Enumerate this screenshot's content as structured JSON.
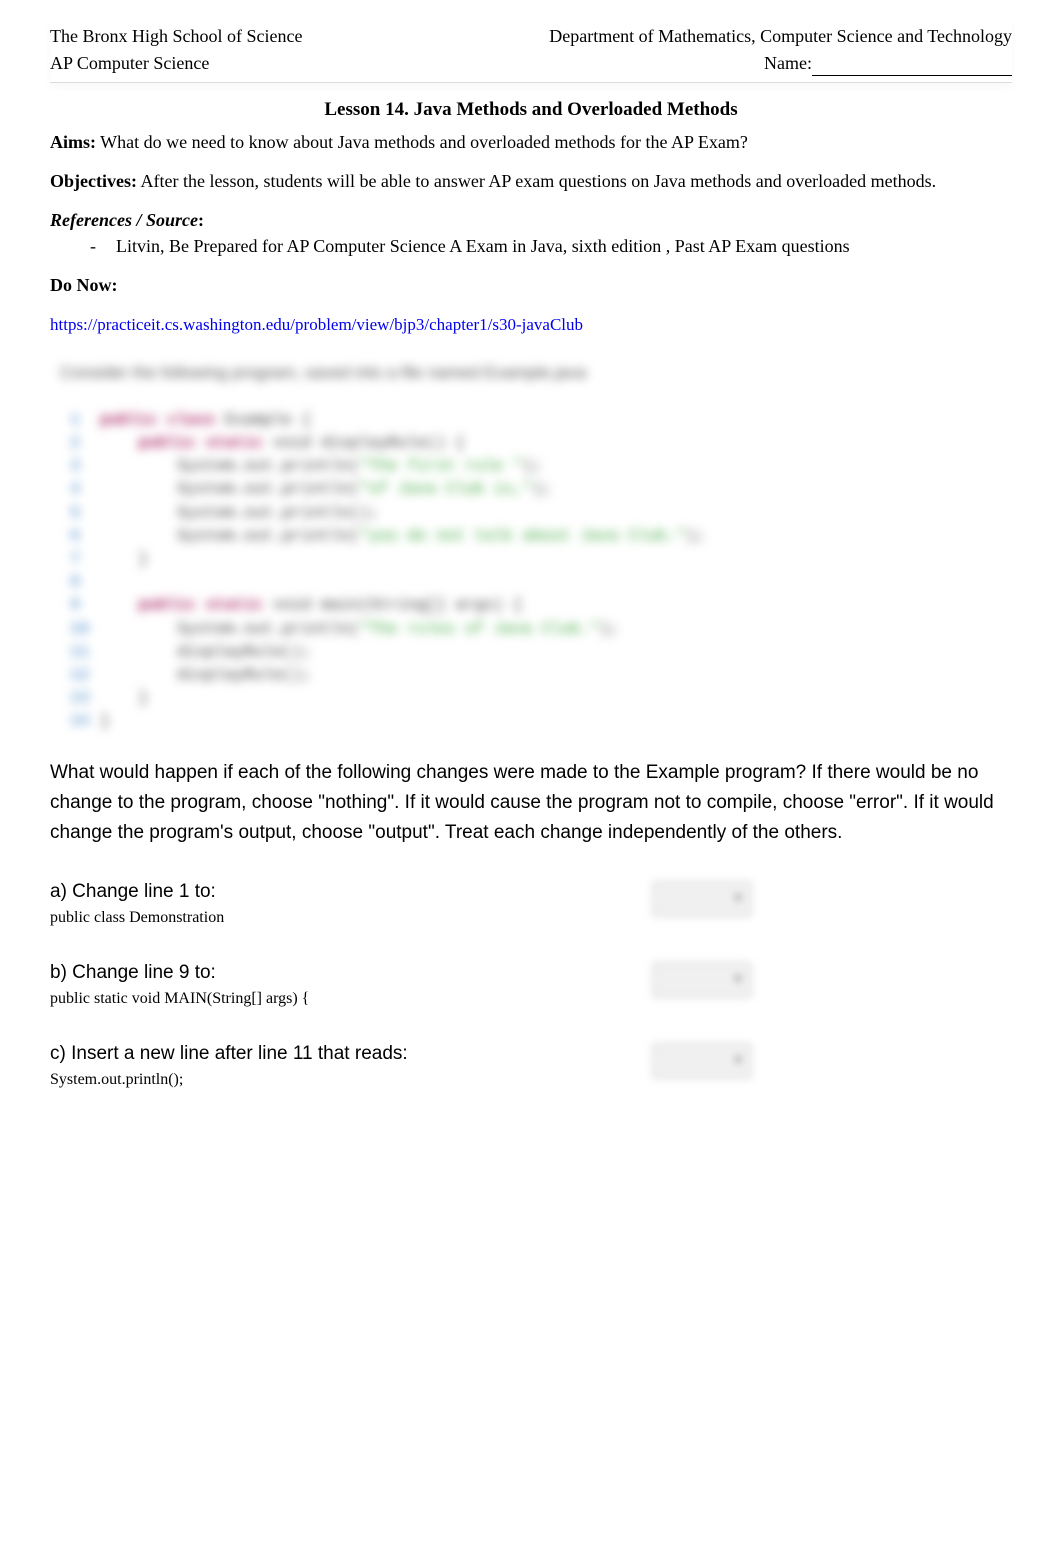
{
  "header": {
    "school": "The Bronx High School of Science",
    "department": "Department of Mathematics, Computer Science and Technology",
    "course": "AP Computer Science",
    "nameLabel": "Name:"
  },
  "title": "Lesson 14. Java Methods and Overloaded Methods",
  "aims": {
    "label": "Aims:",
    "text": " What do we need to know about Java methods and overloaded methods for the AP Exam?"
  },
  "objectives": {
    "label": "Objectives:",
    "text": " After the lesson, students will be able to answer AP exam questions on Java methods and overloaded methods."
  },
  "references": {
    "label": "References / Source",
    "colon": ":",
    "dash": "-",
    "item": "Litvin, Be Prepared for AP Computer Science A Exam in Java, sixth edition , Past AP Exam questions"
  },
  "doNow": {
    "label": "Do Now:",
    "linkText": "https://practiceit.cs.washington.edu/problem/view/bjp3/chapter1/s30-javaClub"
  },
  "blurred": {
    "intro": "Consider the following program, saved into a file named Example.java",
    "lines": [
      {
        "n": "1",
        "indent": "",
        "t": [
          {
            "c": "kw",
            "v": "public class"
          },
          {
            "c": "plain",
            "v": " Example {"
          }
        ]
      },
      {
        "n": "2",
        "indent": "    ",
        "t": [
          {
            "c": "kw",
            "v": "public static"
          },
          {
            "c": "plain",
            "v": " void displayRule() {"
          }
        ]
      },
      {
        "n": "3",
        "indent": "        ",
        "t": [
          {
            "c": "plain",
            "v": "System.out.println("
          },
          {
            "c": "str",
            "v": "\"The first rule \""
          },
          {
            "c": "plain",
            "v": ");"
          }
        ]
      },
      {
        "n": "4",
        "indent": "        ",
        "t": [
          {
            "c": "plain",
            "v": "System.out.println("
          },
          {
            "c": "str",
            "v": "\"of Java Club is,\""
          },
          {
            "c": "plain",
            "v": ");"
          }
        ]
      },
      {
        "n": "5",
        "indent": "        ",
        "t": [
          {
            "c": "plain",
            "v": "System.out.println();"
          }
        ]
      },
      {
        "n": "6",
        "indent": "        ",
        "t": [
          {
            "c": "plain",
            "v": "System.out.println("
          },
          {
            "c": "str",
            "v": "\"you do not talk about Java Club.\""
          },
          {
            "c": "plain",
            "v": ");"
          }
        ]
      },
      {
        "n": "7",
        "indent": "    ",
        "t": [
          {
            "c": "plain",
            "v": "}"
          }
        ]
      },
      {
        "n": "8",
        "indent": "",
        "t": [
          {
            "c": "plain",
            "v": ""
          }
        ]
      },
      {
        "n": "9",
        "indent": "    ",
        "t": [
          {
            "c": "kw",
            "v": "public static"
          },
          {
            "c": "plain",
            "v": " void main(String[] args) {"
          }
        ]
      },
      {
        "n": "10",
        "indent": "        ",
        "t": [
          {
            "c": "plain",
            "v": "System.out.println("
          },
          {
            "c": "str",
            "v": "\"The rules of Java Club.\""
          },
          {
            "c": "plain",
            "v": ");"
          }
        ]
      },
      {
        "n": "11",
        "indent": "        ",
        "t": [
          {
            "c": "plain",
            "v": "displayRule();"
          }
        ]
      },
      {
        "n": "12",
        "indent": "        ",
        "t": [
          {
            "c": "plain",
            "v": "displayRule();"
          }
        ]
      },
      {
        "n": "13",
        "indent": "    ",
        "t": [
          {
            "c": "plain",
            "v": "}"
          }
        ]
      },
      {
        "n": "14",
        "indent": "",
        "t": [
          {
            "c": "plain",
            "v": "}"
          }
        ]
      }
    ]
  },
  "questionText": "What would happen if each of the following changes were made to the Example program? If there would be no change to the program, choose \"nothing\". If it would cause the program not to compile, choose \"error\". If it would change the program's output, choose \"output\". Treat each change independently of the others.",
  "questions": [
    {
      "prompt": "a) Change line 1 to:",
      "code": "public class Demonstration"
    },
    {
      "prompt": "b) Change line 9 to:",
      "code": "public static void MAIN(String[] args) {"
    },
    {
      "prompt": "c) Insert a new line after line 11 that reads:",
      "code": "System.out.println();"
    }
  ]
}
